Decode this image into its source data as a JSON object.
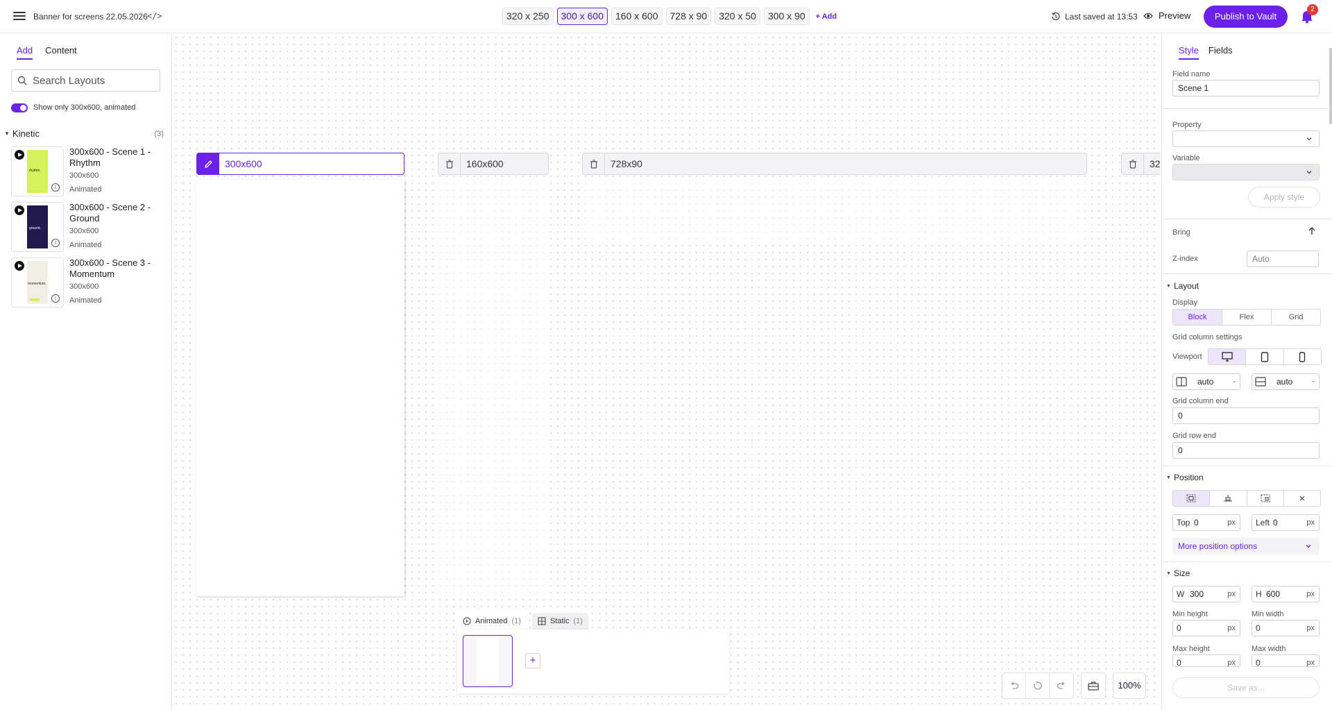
{
  "header": {
    "document_title": "Banner for screens 22.05.2026",
    "code_label": "</>",
    "sizes": [
      "320 x 250",
      "300 x 600",
      "160 x 600",
      "728 x 90",
      "320 x 50",
      "300 x 90"
    ],
    "active_size": "300 x 600",
    "add_label": "+ Add",
    "saved_label": "Last saved at 13:53",
    "preview_label": "Preview",
    "publish_label": "Publish to Vault",
    "notification_count": "2",
    "accent_color": "#6b21e8"
  },
  "left_panel": {
    "tabs": [
      {
        "label": "Add",
        "active": true
      },
      {
        "label": "Content",
        "active": false
      }
    ],
    "search_placeholder": "Search Layouts",
    "toggle_label": "Show only 300x600, animated",
    "toggle_on": true,
    "group": {
      "label": "Kinetic",
      "count": "(3)"
    },
    "layouts": [
      {
        "name": "300x600 - Scene 1 - Rhythm",
        "size": "300x600",
        "type": "Animated",
        "thumb_color": "#d4f05a",
        "thumb_text": "rhythm."
      },
      {
        "name": "300x600 - Scene 2 - Ground",
        "size": "300x600",
        "type": "Animated",
        "thumb_color": "#221a4f",
        "thumb_text": "ground."
      },
      {
        "name": "300x600 - Scene 3 - Momentum",
        "size": "300x600",
        "type": "Animated",
        "thumb_color": "#f1eee6",
        "thumb_text": "momentum."
      }
    ]
  },
  "canvas": {
    "frames": [
      {
        "label": "300x600",
        "active": true
      },
      {
        "label": "160x600",
        "active": false
      },
      {
        "label": "728x90",
        "active": false
      },
      {
        "label": "32",
        "active": false
      }
    ],
    "scene_tabs": [
      {
        "label": "Animated",
        "count": "(1)",
        "active": true
      },
      {
        "label": "Static",
        "count": "(1)",
        "active": false
      }
    ],
    "scene_add_label": "+",
    "zoom": "100%"
  },
  "right_panel": {
    "tabs": [
      {
        "label": "Style",
        "active": true
      },
      {
        "label": "Fields",
        "active": false
      }
    ],
    "field_name_label": "Field name",
    "field_name_value": "Scene 1",
    "property_label": "Property",
    "variable_label": "Variable",
    "apply_label": "Apply style",
    "bring_label": "Bring",
    "zindex_label": "Z-index",
    "zindex_placeholder": "Auto",
    "layout_section": "Layout",
    "display_label": "Display",
    "display_options": [
      {
        "label": "Block",
        "active": true
      },
      {
        "label": "Flex",
        "active": false
      },
      {
        "label": "Grid",
        "active": false
      }
    ],
    "grid_col_settings_label": "Grid column settings",
    "viewport_label": "Viewport",
    "col_auto": "auto",
    "row_auto": "auto",
    "minus": "-",
    "grid_col_end_label": "Grid column end",
    "grid_col_end_value": "0",
    "grid_row_end_label": "Grid row end",
    "grid_row_end_value": "0",
    "position_section": "Position",
    "top_prefix": "Top",
    "top_value": "0",
    "left_prefix": "Left",
    "left_value": "0",
    "unit_px": "px",
    "more_position_label": "More position options",
    "size_section": "Size",
    "w_prefix": "W",
    "w_value": "300",
    "h_prefix": "H",
    "h_value": "600",
    "min_height_label": "Min height",
    "min_height_value": "0",
    "min_width_label": "Min width",
    "min_width_value": "0",
    "max_height_label": "Max height",
    "max_height_value": "0",
    "max_width_label": "Max width",
    "max_width_value": "0",
    "save_as_label": "Save as..."
  }
}
